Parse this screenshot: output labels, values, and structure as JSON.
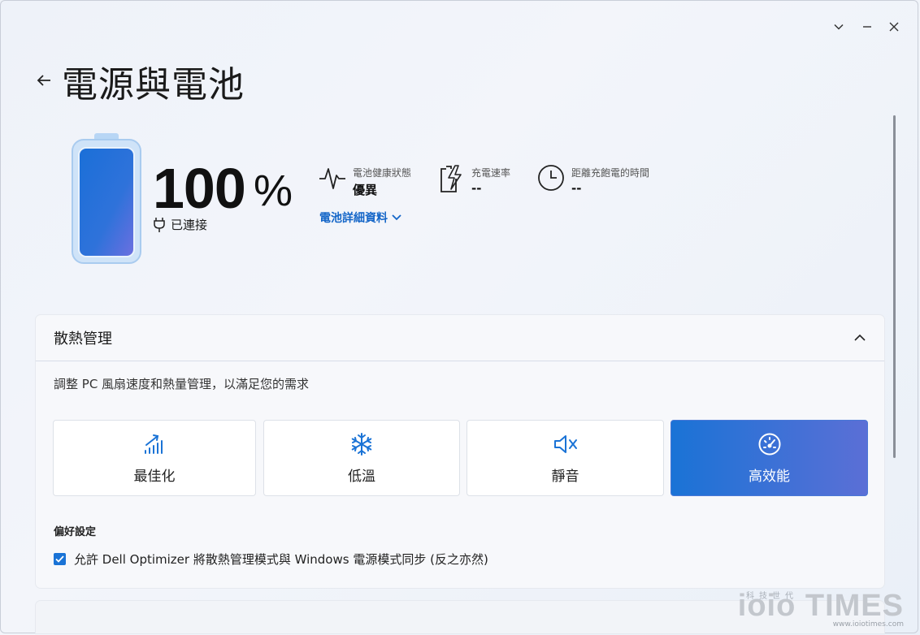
{
  "page": {
    "title": "電源與電池"
  },
  "battery": {
    "percent": "100",
    "percent_symbol": "%",
    "level": 1.0,
    "status": "已連接"
  },
  "stats": [
    {
      "label": "電池健康狀態",
      "value": "優異",
      "icon": "heartbeat-icon"
    },
    {
      "label": "充電速率",
      "value": "--",
      "icon": "charging-bolt-icon"
    },
    {
      "label": "距離充飽電的時間",
      "value": "--",
      "icon": "clock-icon"
    }
  ],
  "details_link": "電池詳細資料",
  "thermal": {
    "title": "散熱管理",
    "description": "調整 PC 風扇速度和熱量管理，以滿足您的需求",
    "modes": [
      {
        "label": "最佳化",
        "icon": "optimize-signal-icon",
        "active": false
      },
      {
        "label": "低溫",
        "icon": "snowflake-icon",
        "active": false
      },
      {
        "label": "靜音",
        "icon": "mute-speaker-icon",
        "active": false
      },
      {
        "label": "高效能",
        "icon": "speedometer-icon",
        "active": true
      }
    ],
    "preferences_title": "偏好設定",
    "sync_checkbox": {
      "label": "允許 Dell Optimizer 將散熱管理模式與 Windows 電源模式同步 (反之亦然)",
      "checked": true
    }
  },
  "watermark": {
    "small": "科技世代",
    "brand": "ioio TIMES",
    "url": "www.ioiotimes.com"
  },
  "colors": {
    "accent": "#1a73d6",
    "link": "#1466c8"
  }
}
